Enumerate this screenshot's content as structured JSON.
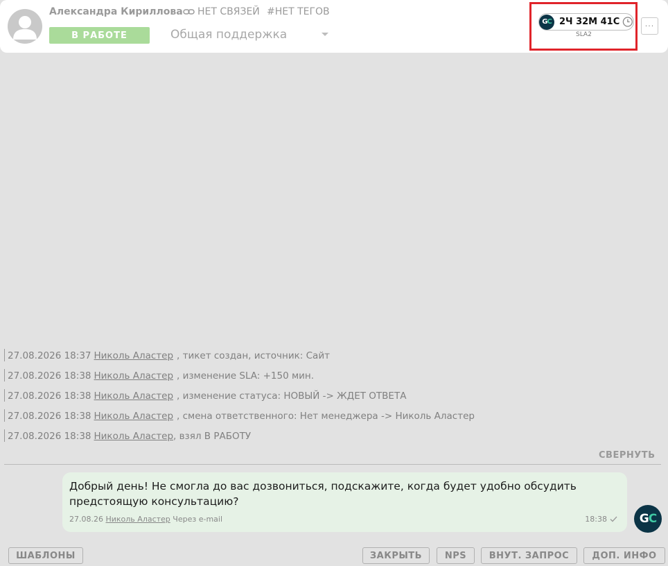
{
  "header": {
    "client_name": "Александра Кириллова",
    "links_label": "НЕТ СВЯЗЕЙ",
    "tags_label": "#НЕТ ТЕГОВ",
    "status_label": "В РАБОТЕ",
    "department": "Общая поддержка",
    "sla_logo": "GC",
    "sla_timer": "2Ч 32М 41С",
    "sla_name": "SLA2",
    "more_label": "···",
    "colors": {
      "status": "#aadb9a",
      "highlight": "#e0242a",
      "brand_dark": "#0b3446",
      "brand_accent": "#3fc9a4"
    },
    "icons": [
      "avatar-icon",
      "link-icon",
      "clock-icon",
      "chevron-down-icon",
      "more-icon"
    ]
  },
  "events": [
    {
      "datetime": "27.08.2026 18:37",
      "author": "Николь Аластер",
      "text": ", тикет создан, источник: Сайт"
    },
    {
      "datetime": "27.08.2026 18:38",
      "author": "Николь Аластер",
      "text": ", изменение SLA: +150 мин."
    },
    {
      "datetime": "27.08.2026 18:38",
      "author": "Николь Аластер",
      "text": ", изменение статуса: НОВЫЙ -> ЖДЕТ ОТВЕТА"
    },
    {
      "datetime": "27.08.2026 18:38",
      "author": "Николь Аластер",
      "text": ", смена ответственного: Нет менеджера -> Николь Аластер"
    },
    {
      "datetime": "27.08.2026 18:38",
      "author": "Николь Аластер",
      "text": ", взял В РАБОТУ"
    }
  ],
  "collapse_label": "СВЕРНУТЬ",
  "message": {
    "text": "Добрый день! Не смогла до вас дозвониться, подскажите, когда будет удобно обсудить предстоящую консультацию?",
    "date": "27.08.26",
    "author": "Николь Аластер",
    "channel": "Через e-mail",
    "time": "18:38",
    "avatar_logo": "GC"
  },
  "footer": {
    "templates": "ШАБЛОНЫ",
    "close": "ЗАКРЫТЬ",
    "nps": "NPS",
    "internal": "ВНУТ. ЗАПРОС",
    "extra": "ДОП. ИНФО"
  }
}
